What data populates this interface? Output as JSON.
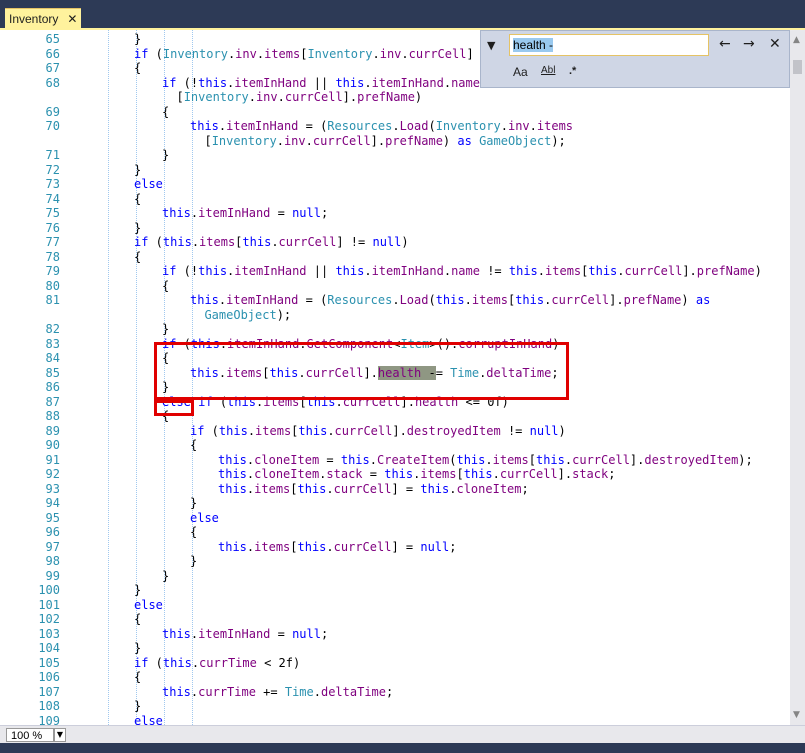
{
  "tab": {
    "title": "Inventory",
    "close": "✕"
  },
  "find": {
    "value": "health -",
    "prev": "←",
    "next": "→",
    "close": "✕",
    "toggle": "▼",
    "match_case": "Aa",
    "whole_word": "Abl",
    "regex": ".*"
  },
  "zoom": {
    "value": "100 %"
  },
  "colors": {
    "keyword": "#0000ff",
    "type": "#2b91af",
    "member": "#7f007f",
    "tab": "#fff29d",
    "frame": "#2d3a56",
    "highlight": "#e00000"
  },
  "line_numbers": [
    "65",
    "66",
    "67",
    "68",
    "",
    "69",
    "70",
    "",
    "71",
    "72",
    "73",
    "74",
    "75",
    "76",
    "77",
    "78",
    "79",
    "80",
    "81",
    "",
    "82",
    "83",
    "84",
    "85",
    "86",
    "87",
    "88",
    "89",
    "90",
    "91",
    "92",
    "93",
    "94",
    "95",
    "96",
    "97",
    "98",
    "99",
    "100",
    "101",
    "102",
    "103",
    "104",
    "105",
    "106",
    "107",
    "108",
    "109"
  ],
  "code_lines": [
    {
      "indent": 1,
      "text": "}"
    },
    {
      "indent": 1,
      "text": "if (Inventory.inv.items[Inventory.inv.currCell] !="
    },
    {
      "indent": 1,
      "text": "{"
    },
    {
      "indent": 2,
      "text": "if (!this.itemInHand || this.itemInHand.name"
    },
    {
      "indent": 2,
      "text": "  [Inventory.inv.currCell].prefName)"
    },
    {
      "indent": 2,
      "text": "{"
    },
    {
      "indent": 3,
      "text": "this.itemInHand = (Resources.Load(Inventory.inv.items"
    },
    {
      "indent": 3,
      "text": "  [Inventory.inv.currCell].prefName) as GameObject);"
    },
    {
      "indent": 2,
      "text": "}"
    },
    {
      "indent": 1,
      "text": "}"
    },
    {
      "indent": 1,
      "text": "else"
    },
    {
      "indent": 1,
      "text": "{"
    },
    {
      "indent": 2,
      "text": "this.itemInHand = null;"
    },
    {
      "indent": 1,
      "text": "}"
    },
    {
      "indent": 1,
      "text": "if (this.items[this.currCell] != null)"
    },
    {
      "indent": 1,
      "text": "{"
    },
    {
      "indent": 2,
      "text": "if (!this.itemInHand || this.itemInHand.name != this.items[this.currCell].prefName)"
    },
    {
      "indent": 2,
      "text": "{"
    },
    {
      "indent": 3,
      "text": "this.itemInHand = (Resources.Load(this.items[this.currCell].prefName) as"
    },
    {
      "indent": 3,
      "text": "  GameObject);"
    },
    {
      "indent": 2,
      "text": "}"
    },
    {
      "indent": 2,
      "text": "if (this.itemInHand.GetComponent<Item>().corruptInHand)"
    },
    {
      "indent": 2,
      "text": "{"
    },
    {
      "indent": 3,
      "text": "this.items[this.currCell].health -= Time.deltaTime;"
    },
    {
      "indent": 2,
      "text": "}"
    },
    {
      "indent": 2,
      "text": "else if (this.items[this.currCell].health <= 0f)"
    },
    {
      "indent": 2,
      "text": "{"
    },
    {
      "indent": 3,
      "text": "if (this.items[this.currCell].destroyedItem != null)"
    },
    {
      "indent": 3,
      "text": "{"
    },
    {
      "indent": 4,
      "text": "this.cloneItem = this.CreateItem(this.items[this.currCell].destroyedItem);"
    },
    {
      "indent": 4,
      "text": "this.cloneItem.stack = this.items[this.currCell].stack;"
    },
    {
      "indent": 4,
      "text": "this.items[this.currCell] = this.cloneItem;"
    },
    {
      "indent": 3,
      "text": "}"
    },
    {
      "indent": 3,
      "text": "else"
    },
    {
      "indent": 3,
      "text": "{"
    },
    {
      "indent": 4,
      "text": "this.items[this.currCell] = null;"
    },
    {
      "indent": 3,
      "text": "}"
    },
    {
      "indent": 2,
      "text": "}"
    },
    {
      "indent": 1,
      "text": "}"
    },
    {
      "indent": 1,
      "text": "else"
    },
    {
      "indent": 1,
      "text": "{"
    },
    {
      "indent": 2,
      "text": "this.itemInHand = null;"
    },
    {
      "indent": 1,
      "text": "}"
    },
    {
      "indent": 1,
      "text": "if (this.currTime < 2f)"
    },
    {
      "indent": 1,
      "text": "{"
    },
    {
      "indent": 2,
      "text": "this.currTime += Time.deltaTime;"
    },
    {
      "indent": 1,
      "text": "}"
    },
    {
      "indent": 1,
      "text": "else"
    }
  ]
}
